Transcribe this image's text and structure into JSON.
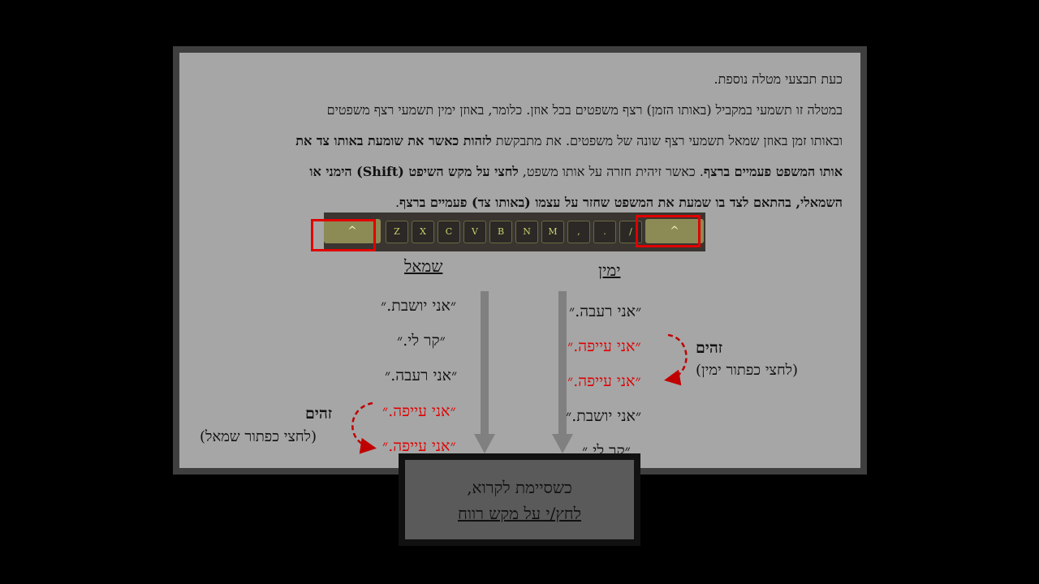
{
  "instructions": {
    "line1": "כעת תבצעי מטלה נוספת.",
    "line2": "במטלה זו תשמעי במקביל (באותו הזמן) רצף משפטים בכל אוזן. כלומר, באוזן ימין תשמעי רצף משפטים",
    "line3_normal": "ובאותו זמן באוזן שמאל תשמעי רצף שונה של משפטים. את מתבקשת ",
    "line3_bold": "לזהות כאשר את שומעת באותו צד את",
    "line4_bold1": "אותו המשפט פעמיים ברצף",
    "line4_normal": ". כאשר זיהית חזרה על אותו משפט, ",
    "line4_bold2": "לחצי על מקש השיפט (Shift) הימני או",
    "line5_bold": "השמאלי, בהתאם לצד בו שמעת את המשפט שחזר על עצמו (באותו צד) פעמיים ברצף",
    "line5_end": "."
  },
  "keyboard": {
    "keys": [
      "Z",
      "X",
      "C",
      "V",
      "B",
      "N",
      "M",
      ",",
      ".",
      "/"
    ],
    "shift_glyph": "^"
  },
  "left_column": {
    "heading": "שמאל",
    "sentences": [
      {
        "text": "״אני יושבת.״",
        "repeat": false
      },
      {
        "text": "״קר לי.״",
        "repeat": false
      },
      {
        "text": "״אני רעבה.״",
        "repeat": false
      },
      {
        "text": "״אני עייפה.״",
        "repeat": true
      },
      {
        "text": "״אני עייפה.״",
        "repeat": true
      }
    ],
    "same_label": "זהים",
    "same_hint": "(לחצי כפתור שמאל)"
  },
  "right_column": {
    "heading": "ימין",
    "sentences": [
      {
        "text": "״אני רעבה.״",
        "repeat": false
      },
      {
        "text": "״אני עייפה.״",
        "repeat": true
      },
      {
        "text": "״אני עייפה.״",
        "repeat": true
      },
      {
        "text": "״אני יושבת.״",
        "repeat": false
      },
      {
        "text": "״קר לי.״",
        "repeat": false
      }
    ],
    "same_label": "זהים",
    "same_hint": "(לחצי כפתור ימין)"
  },
  "cta": {
    "line1": "כשסיימת לקרוא,",
    "line2": "לחץ/י על מקש רווח"
  },
  "colors": {
    "background": "#000000",
    "panel": "#a6a6a6",
    "highlight_red": "#e00000",
    "arrow_gray": "#808080",
    "cta_box": "#5a5a5a"
  }
}
